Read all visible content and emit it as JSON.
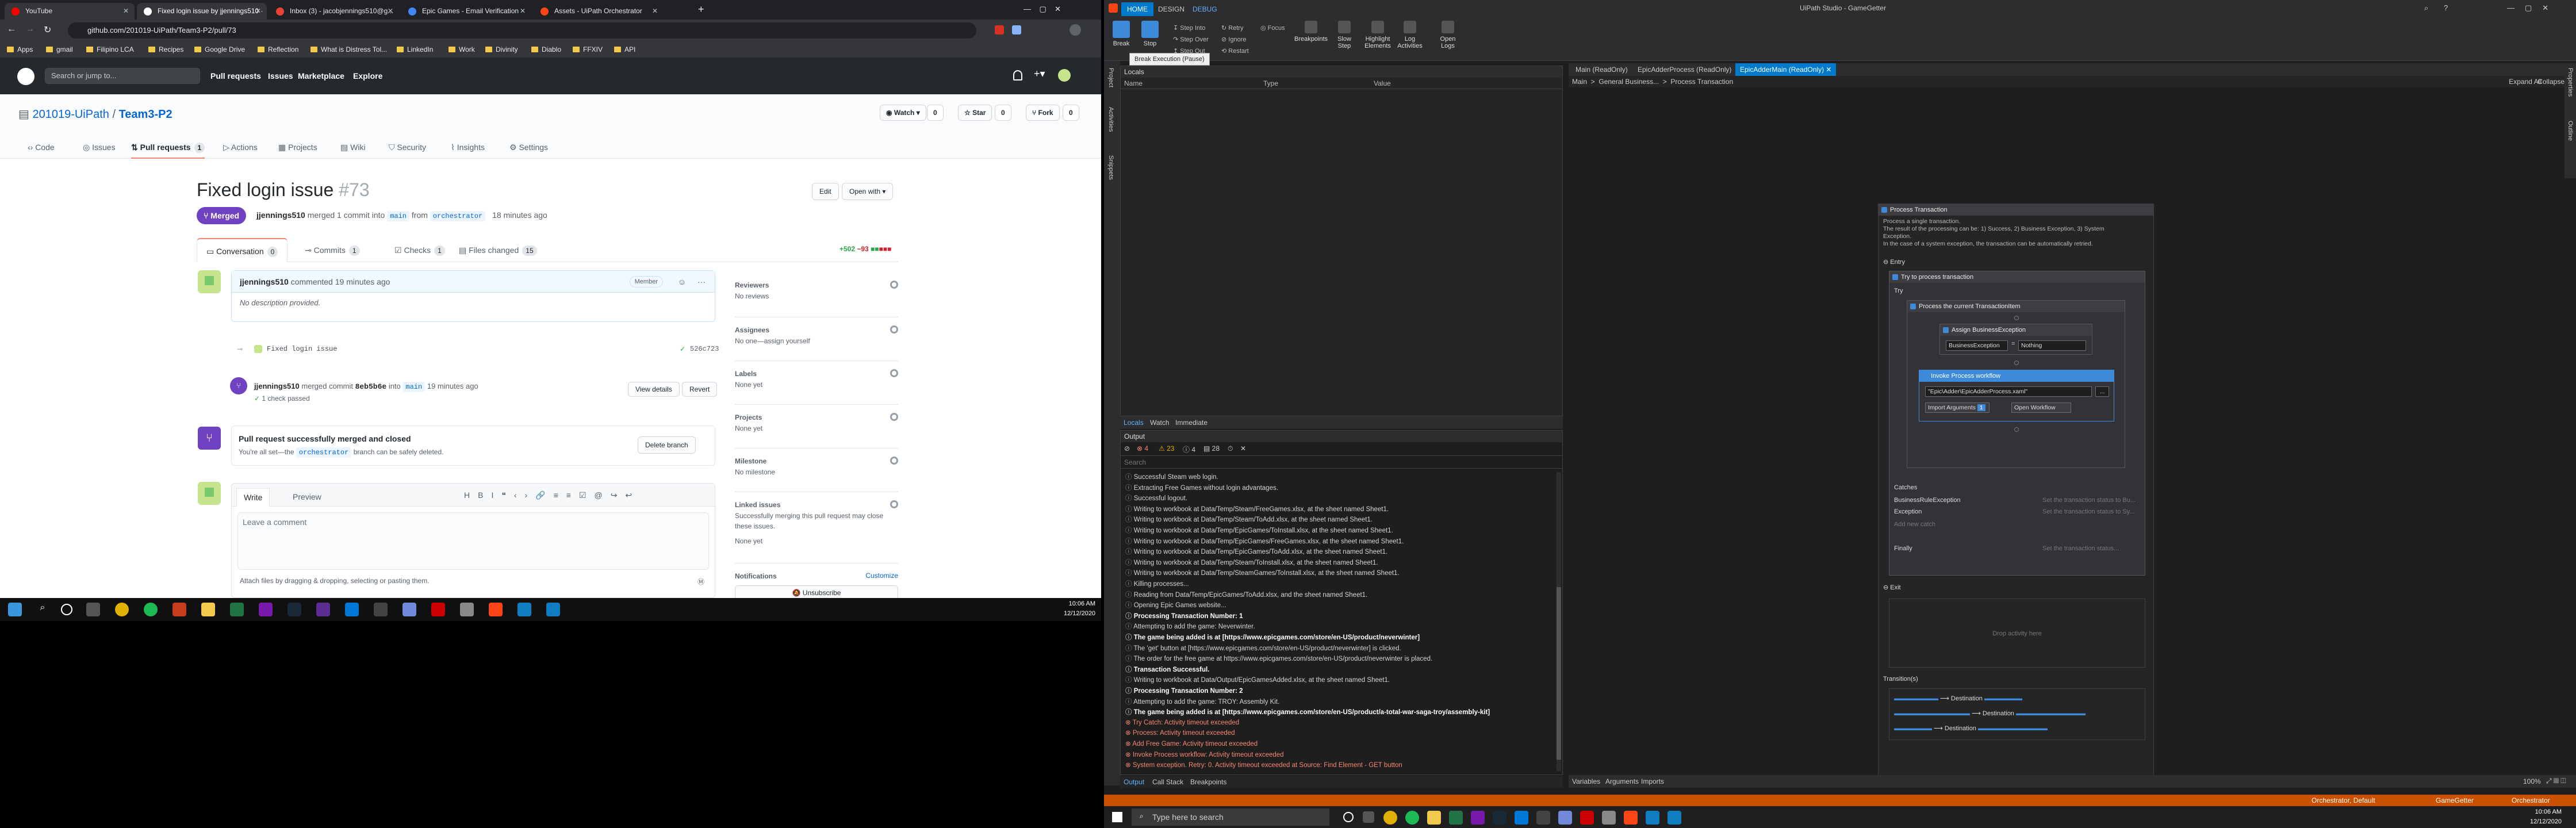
{
  "browser": {
    "tabs": [
      {
        "title": "YouTube",
        "color": "#ff0000"
      },
      {
        "title": "Fixed login issue by jjennings510 ·",
        "color": "#ffffff"
      },
      {
        "title": "Inbox (3) - jacobjennings510@g...",
        "color": "#ea4335"
      },
      {
        "title": "Epic Games - Email Verification",
        "color": "#4285f4"
      },
      {
        "title": "Assets - UiPath Orchestrator",
        "color": "#fa4616"
      }
    ],
    "new_tab": "+",
    "url": "github.com/201019-UiPath/Team3-P2/pull/73",
    "bookmarks": [
      "Apps",
      "gmail",
      "Filipino LCA",
      "Recipes",
      "Google Drive",
      "Reflection",
      "What is Distress Tol...",
      "LinkedIn",
      "Work",
      "Divinity",
      "Diablo",
      "FFXIV",
      "API"
    ]
  },
  "github": {
    "search_placeholder": "Search or jump to...",
    "nav": [
      "Pull requests",
      "Issues",
      "Marketplace",
      "Explore"
    ],
    "repo_owner": "201019-UiPath",
    "repo_sep": " / ",
    "repo_name": "Team3-P2",
    "watch": "Watch",
    "watch_count": "0",
    "star": "Star",
    "star_count": "0",
    "fork": "Fork",
    "fork_count": "0",
    "repo_tabs": [
      {
        "label": "Code",
        "count": ""
      },
      {
        "label": "Issues",
        "count": ""
      },
      {
        "label": "Pull requests",
        "count": "1"
      },
      {
        "label": "Actions",
        "count": ""
      },
      {
        "label": "Projects",
        "count": ""
      },
      {
        "label": "Wiki",
        "count": ""
      },
      {
        "label": "Security",
        "count": ""
      },
      {
        "label": "Insights",
        "count": ""
      },
      {
        "label": "Settings",
        "count": ""
      }
    ],
    "pr_title": "Fixed login issue",
    "pr_number": "#73",
    "edit": "Edit",
    "open_with": "Open with",
    "state": "Merged",
    "merge_user": "jjennings510",
    "merge_text": "merged 1 commit into",
    "base_branch": "main",
    "from_text": "from",
    "head_branch": "orchestrator",
    "merge_time": "18 minutes ago",
    "pr_tabs": [
      {
        "label": "Conversation",
        "count": "0"
      },
      {
        "label": "Commits",
        "count": "1"
      },
      {
        "label": "Checks",
        "count": "1"
      },
      {
        "label": "Files changed",
        "count": "15"
      }
    ],
    "diff_add": "+502",
    "diff_del": "−93",
    "comment_user": "jjennings510",
    "comment_time": "commented 19 minutes ago",
    "member_badge": "Member",
    "comment_body": "No description provided.",
    "commit_msg": "Fixed login issue",
    "commit_check": "✓",
    "commit_sha": "526c723",
    "merge_event_user": "jjennings510",
    "merge_event_text": "merged commit",
    "merge_event_sha": "8eb5b6e",
    "merge_event_into": "into",
    "merge_event_branch": "main",
    "merge_event_time": "19 minutes ago",
    "checks_passed": "1 check passed",
    "view_details": "View details",
    "revert": "Revert",
    "merged_box_title": "Pull request successfully merged and closed",
    "merged_box_text_1": "You're all set—the",
    "merged_box_branch": "orchestrator",
    "merged_box_text_2": "branch can be safely deleted.",
    "delete_branch": "Delete branch",
    "write_tab": "Write",
    "preview_tab": "Preview",
    "comment_placeholder": "Leave a comment",
    "attach_text": "Attach files by dragging & dropping, selecting or pasting them.",
    "sidebar": [
      {
        "head": "Reviewers",
        "value": "No reviews"
      },
      {
        "head": "Assignees",
        "value": "No one—assign yourself"
      },
      {
        "head": "Labels",
        "value": "None yet"
      },
      {
        "head": "Projects",
        "value": "None yet"
      },
      {
        "head": "Milestone",
        "value": "No milestone"
      },
      {
        "head": "Linked issues",
        "value": "Successfully merging this pull request may close these issues."
      },
      {
        "head": "",
        "value": "None yet"
      },
      {
        "head": "Notifications",
        "value": "Customize"
      }
    ],
    "unsubscribe": "Unsubscribe"
  },
  "left_clock": {
    "time": "10:06 AM",
    "date": "12/12/2020"
  },
  "studio": {
    "title": "UiPath Studio - GameGetter",
    "ribbon_tabs": [
      "HOME",
      "DESIGN",
      "DEBUG"
    ],
    "ribbon_big": [
      "Break",
      "Stop"
    ],
    "ribbon_small": [
      "Step Into",
      "Step Over",
      "Step Out",
      "Retry",
      "Ignore",
      "Restart",
      "Focus"
    ],
    "ribbon_right": [
      "Breakpoints",
      "Slow Step",
      "Highlight Elements",
      "Log Activities",
      "Open Logs"
    ],
    "tooltip": "Break Execution (Pause)",
    "locals_title": "Locals",
    "locals_cols": [
      "Name",
      "Type",
      "Value"
    ],
    "left_vtabs": [
      "Project",
      "Activities",
      "Snippets"
    ],
    "lower_tabs": [
      "Locals",
      "Watch",
      "Immediate"
    ],
    "output_title": "Output",
    "output_search": "Search",
    "output_counts": [
      "4",
      "23",
      "4",
      "28"
    ],
    "output_lines": [
      {
        "t": "Successful Steam web login.",
        "k": ""
      },
      {
        "t": "Extracting Free Games without login advantages.",
        "k": ""
      },
      {
        "t": "Successful logout.",
        "k": ""
      },
      {
        "t": "Writing to workbook at Data/Temp/Steam/FreeGames.xlsx, at the sheet named Sheet1.",
        "k": ""
      },
      {
        "t": "Writing to workbook at Data/Temp/Steam/ToAdd.xlsx, at the sheet named Sheet1.",
        "k": ""
      },
      {
        "t": "Writing to workbook at Data/Temp/EpicGames/ToInstall.xlsx, at the sheet named Sheet1.",
        "k": ""
      },
      {
        "t": "Writing to workbook at Data/Temp/EpicGames/FreeGames.xlsx, at the sheet named Sheet1.",
        "k": ""
      },
      {
        "t": "Writing to workbook at Data/Temp/EpicGames/ToAdd.xlsx, at the sheet named Sheet1.",
        "k": ""
      },
      {
        "t": "Writing to workbook at Data/Temp/Steam/ToInstall.xlsx, at the sheet named Sheet1.",
        "k": ""
      },
      {
        "t": "Writing to workbook at Data/Temp/SteamGames/ToInstall.xlsx, at the sheet named Sheet1.",
        "k": ""
      },
      {
        "t": "Killing processes...",
        "k": ""
      },
      {
        "t": "Reading from Data/Temp/EpicGames/ToAdd.xlsx, and the sheet named Sheet1.",
        "k": ""
      },
      {
        "t": "Opening Epic Games website...",
        "k": ""
      },
      {
        "t": "Processing Transaction Number: 1",
        "k": "b"
      },
      {
        "t": "Attempting to add the game: Neverwinter.",
        "k": ""
      },
      {
        "t": "The game being added is at [https://www.epicgames.com/store/en-US/product/neverwinter]",
        "k": "b"
      },
      {
        "t": "The 'get' button at [https://www.epicgames.com/store/en-US/product/neverwinter] is clicked.",
        "k": ""
      },
      {
        "t": "The order for the free game at https://www.epicgames.com/store/en-US/product/neverwinter is placed.",
        "k": ""
      },
      {
        "t": "Transaction Successful.",
        "k": "b"
      },
      {
        "t": "Writing to workbook at Data/Output/EpicGamesAdded.xlsx, at the sheet named Sheet1.",
        "k": ""
      },
      {
        "t": "Processing Transaction Number: 2",
        "k": "b"
      },
      {
        "t": "Attempting to add the game: TROY: Assembly Kit.",
        "k": ""
      },
      {
        "t": "The game being added is at [https://www.epicgames.com/store/en-US/product/a-total-war-saga-troy/assembly-kit]",
        "k": "b"
      },
      {
        "t": "Try Catch: Activity timeout exceeded",
        "k": "err"
      },
      {
        "t": "Process: Activity timeout exceeded",
        "k": "err"
      },
      {
        "t": "Add Free Game: Activity timeout exceeded",
        "k": "err"
      },
      {
        "t": "Invoke Process workflow: Activity timeout exceeded",
        "k": "err"
      },
      {
        "t": "System exception. Retry: 0. Activity timeout exceeded at Source: Find Element - GET button",
        "k": "err"
      }
    ],
    "output_bottom_tabs": [
      "Output",
      "Call Stack",
      "Breakpoints"
    ],
    "doc_tabs": [
      "Main (ReadOnly)",
      "EpicAdderProcess (ReadOnly)",
      "EpicAdderMain (ReadOnly)"
    ],
    "breadcrumb": [
      "Main",
      "General Business...",
      "Process Transaction"
    ],
    "expand_all": "Expand All",
    "collapse_all": "Collapse All",
    "seq_title": "Process Transaction",
    "seq_annot": [
      "Process a single transaction.",
      "The result of the processing can be: 1) Success, 2) Business Exception, 3) System",
      "Exception.",
      "In the case of a system exception, the transaction can be automatically retried."
    ],
    "entry": "Entry",
    "try_catch": "Try to process transaction",
    "try": "Try",
    "process_item": "Process the current TransactionItem",
    "assign": "Assign BusinessException",
    "assign_to": "BusinessException",
    "assign_eq": "=",
    "assign_val": "Nothing",
    "invoke": "Invoke Process workflow",
    "invoke_path": "\"Epic\\Adder\\EpicAdderProcess.xaml\"",
    "invoke_dots": "...",
    "import_args": "Import Arguments",
    "import_args_count": "1",
    "open_workflow": "Open Workflow",
    "catches": "Catches",
    "catch_rows": [
      {
        "ex": "BusinessRuleException",
        "hint": "Set the transaction status to Bu..."
      },
      {
        "ex": "Exception",
        "hint": "Set the transaction status to Sy..."
      }
    ],
    "add_catch": "Add new catch",
    "finally": "Finally",
    "finally_hint": "Set the transaction status...",
    "exit": "Exit",
    "drop_hint": "Drop activity here",
    "transitions": "Transition(s)",
    "destination": "Destination",
    "var_tabs": [
      "Variables",
      "Arguments",
      "Imports"
    ],
    "zoom": "100%",
    "right_vtabs": [
      "Properties",
      "Outline"
    ],
    "status_left": "",
    "status_items": [
      "Orchestrator, Default",
      "GameGetter",
      "Orchestrator"
    ]
  },
  "taskbar": {
    "search_placeholder": "Type here to search",
    "time": "10:06 AM",
    "date": "12/12/2020"
  }
}
